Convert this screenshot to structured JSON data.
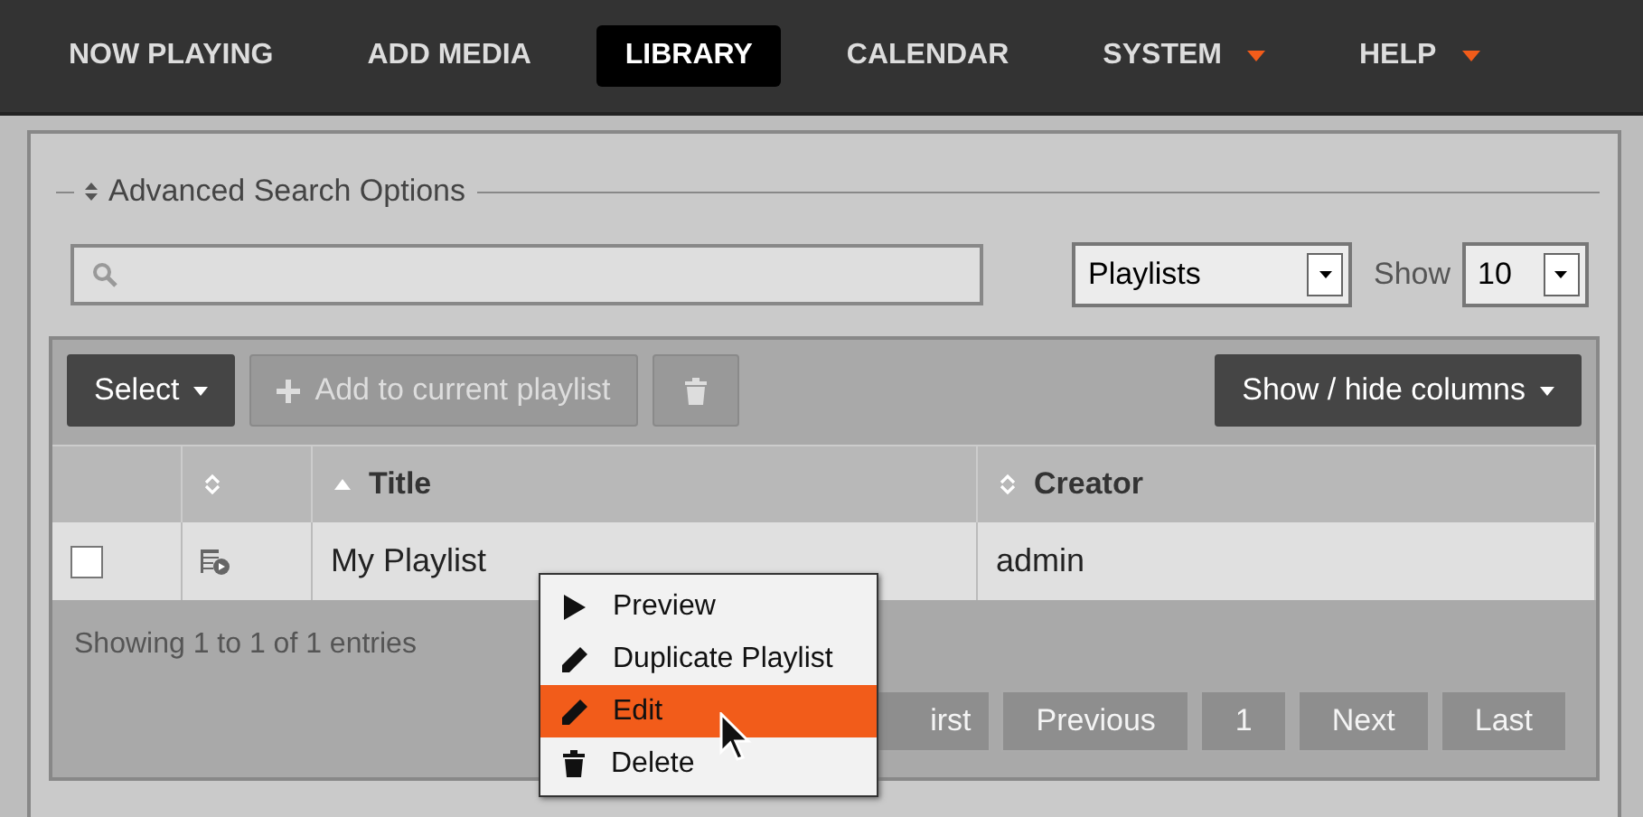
{
  "nav": [
    {
      "label": "NOW PLAYING",
      "selected": false,
      "dropdown": false
    },
    {
      "label": "ADD MEDIA",
      "selected": false,
      "dropdown": false
    },
    {
      "label": "LIBRARY",
      "selected": true,
      "dropdown": false
    },
    {
      "label": "CALENDAR",
      "selected": false,
      "dropdown": false
    },
    {
      "label": "SYSTEM",
      "selected": false,
      "dropdown": true
    },
    {
      "label": "HELP",
      "selected": false,
      "dropdown": true
    }
  ],
  "advanced_search": {
    "label": "Advanced Search Options"
  },
  "filter": {
    "type": "Playlists",
    "show_label": "Show",
    "show_value": "10"
  },
  "toolbar": {
    "select": "Select",
    "add": "Add to current playlist",
    "columns": "Show / hide columns"
  },
  "table": {
    "columns": [
      {
        "kind": "plain"
      },
      {
        "kind": "sortable"
      },
      {
        "label": "Title",
        "kind": "sorted"
      },
      {
        "label": "Creator",
        "kind": "sortable"
      }
    ],
    "rows": [
      {
        "checked": false,
        "title": "My Playlist",
        "creator": "admin"
      }
    ]
  },
  "info": "Showing 1 to 1 of 1 entries",
  "pagination": [
    {
      "label": "irst",
      "kind": "cut"
    },
    {
      "label": "Previous",
      "kind": "page"
    },
    {
      "label": "1",
      "kind": "page"
    },
    {
      "label": "Next",
      "kind": "page"
    },
    {
      "label": "Last",
      "kind": "page"
    }
  ],
  "context_menu": [
    {
      "label": "Preview",
      "kind": "play",
      "selected": false
    },
    {
      "label": "Duplicate Playlist",
      "kind": "pencil",
      "selected": false
    },
    {
      "label": "Edit",
      "kind": "pencil",
      "selected": true
    },
    {
      "label": "Delete",
      "kind": "trash",
      "selected": false
    }
  ]
}
